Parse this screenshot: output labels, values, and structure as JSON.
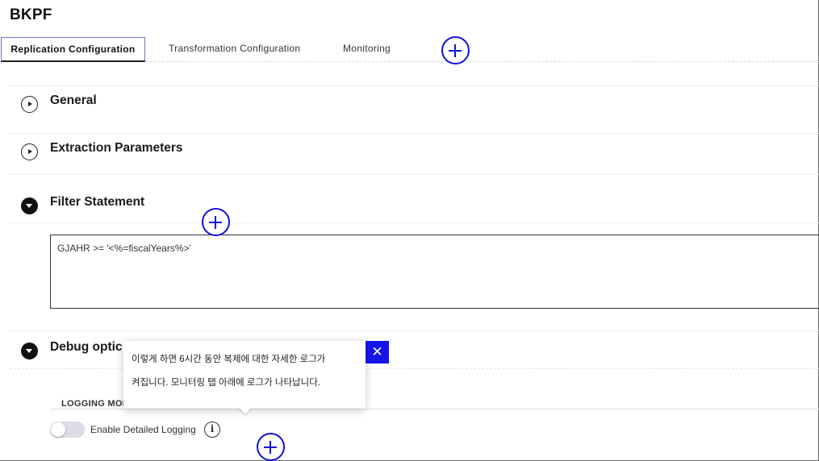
{
  "page": {
    "title": "BKPF"
  },
  "tabs": [
    {
      "label": "Replication Configuration",
      "active": true
    },
    {
      "label": "Transformation Configuration",
      "active": false
    },
    {
      "label": "Monitoring",
      "active": false
    }
  ],
  "sections": {
    "general": {
      "label": "General",
      "state": "collapsed"
    },
    "extraction": {
      "label": "Extraction Parameters",
      "state": "collapsed"
    },
    "filter": {
      "label": "Filter Statement",
      "state": "expanded",
      "value": "GJAHR >= '<%=fiscalYears%>'"
    },
    "debug": {
      "label": "Debug optic",
      "state": "expanded"
    }
  },
  "logging": {
    "heading": "LOGGING MODE",
    "toggle_label": "Enable Detailed Logging",
    "toggle_on": false,
    "info_glyph": "i"
  },
  "tooltip": {
    "line1": "이렇게 하면 6시간 동안 복제에 대한 자세한 로그가",
    "line2": "켜집니다. 모니터링 탭 아래에 로그가 나타납니다.",
    "close_glyph": "✕"
  },
  "icons": {
    "collapsed": "chevron-right-circle-icon",
    "expanded": "chevron-down-circle-icon",
    "add": "plus-circle-icon",
    "info": "info-icon",
    "close": "close-icon"
  },
  "colors": {
    "accent_blue": "#1010d8",
    "tab_border": "#6b74c9",
    "close_button": "#1414e6"
  }
}
